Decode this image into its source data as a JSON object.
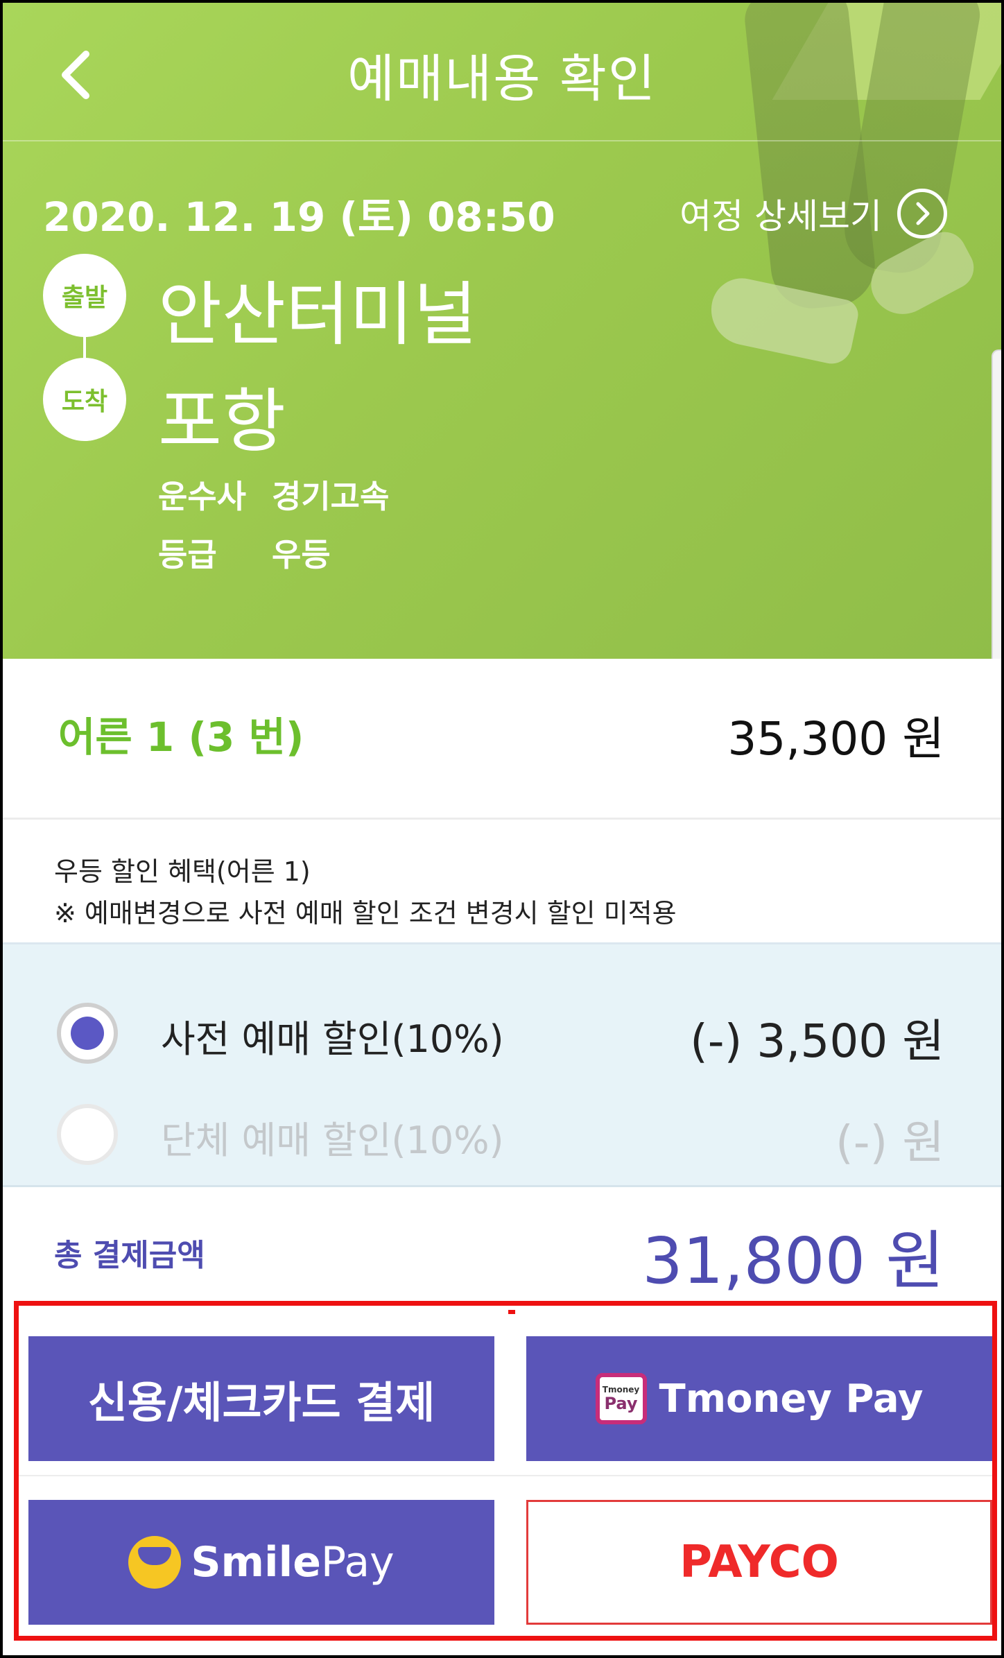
{
  "header": {
    "title": "예매내용 확인",
    "back_icon": "chevron-left-icon"
  },
  "trip": {
    "datetime": "2020. 12. 19 (토) 08:50",
    "detail_link": "여정 상세보기",
    "departure_badge": "출발",
    "departure": "안산터미널",
    "arrival_badge": "도착",
    "arrival": "포항",
    "operator_label": "운수사",
    "operator": "경기고속",
    "grade_label": "등급",
    "grade": "우등"
  },
  "fare": {
    "label": "어른 1 (3 번)",
    "price": "35,300 원"
  },
  "notice": {
    "line1": "우등 할인 혜택(어른 1)",
    "line2": "※ 예매변경으로 사전 예매 할인 조건 변경시 할인 미적용"
  },
  "discounts": [
    {
      "label": "사전 예매 할인(10%)",
      "amount": "(-) 3,500 원",
      "selected": true,
      "enabled": true
    },
    {
      "label": "단체 예매 할인(10%)",
      "amount": "(-) 원",
      "selected": false,
      "enabled": false
    }
  ],
  "total": {
    "label": "총 결제금액",
    "price": "31,800 원"
  },
  "payment": {
    "card": "신용/체크카드 결제",
    "tmoney_badge_top": "Tmoney",
    "tmoney_badge_bottom": "Pay",
    "tmoney": "Tmoney Pay",
    "smile_a": "Smile",
    "smile_b": "Pay",
    "payco": "PAYCO"
  },
  "colors": {
    "hero_green": "#a9d65a",
    "accent_green": "#6cbf2d",
    "purple": "#5a55b8",
    "payco_red": "#ef2a2a",
    "highlight_red": "#ee1111"
  }
}
